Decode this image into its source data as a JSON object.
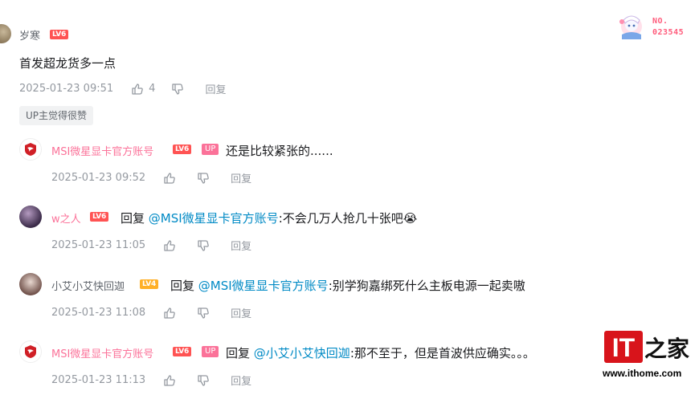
{
  "root_comment": {
    "username": "岁寒",
    "level": "LV6",
    "text": "首发超龙货多一点",
    "time": "2025-01-23 09:51",
    "likes": "4",
    "reply_label": "回复",
    "up_liked": "UP主觉得很赞",
    "badge": {
      "label_line1": "NO.",
      "label_line2": "023545"
    }
  },
  "replies": [
    {
      "username": "MSI微星显卡官方账号",
      "level": "LV6",
      "up_tag": "UP",
      "reply_word": "",
      "at": "",
      "text": "还是比较紧张的......",
      "time": "2025-01-23 09:52",
      "reply_label": "回复"
    },
    {
      "username": "w之人",
      "level": "LV6",
      "up_tag": "",
      "reply_word": "回复",
      "at": "@MSI微星显卡官方账号",
      "text": ":不会几万人抢几十张吧😭",
      "time": "2025-01-23 11:05",
      "reply_label": "回复"
    },
    {
      "username": "小艾小艾快回迦",
      "level": "LV4",
      "up_tag": "",
      "reply_word": "回复",
      "at": "@MSI微星显卡官方账号",
      "text": ":别学狗嘉绑死什么主板电源一起卖嗷",
      "time": "2025-01-23 11:08",
      "reply_label": "回复"
    },
    {
      "username": "MSI微星显卡官方账号",
      "level": "LV6",
      "up_tag": "UP",
      "reply_word": "回复",
      "at": "@小艾小艾快回迦",
      "text": ":那不至于，但是首波供应确实。。。",
      "time": "2025-01-23 11:13",
      "reply_label": "回复"
    }
  ],
  "watermark": {
    "logo_text": "IT之家",
    "url": "www.ithome.com"
  }
}
